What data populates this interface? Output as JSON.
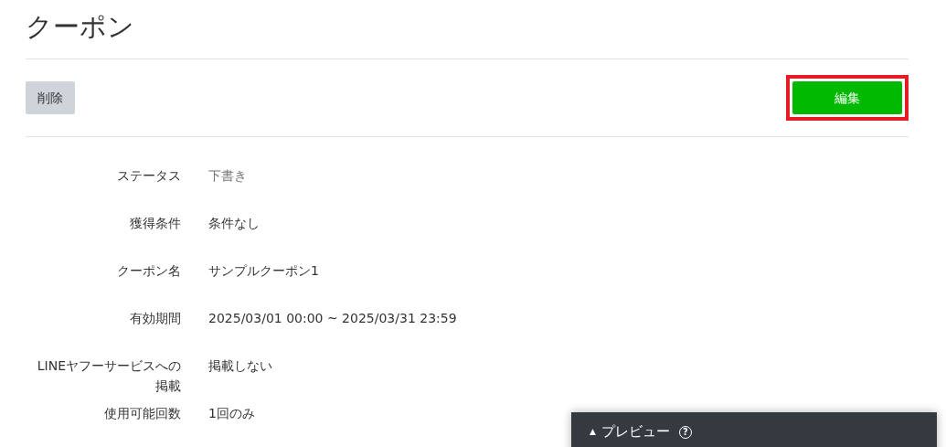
{
  "title": "クーポン",
  "actions": {
    "delete": {
      "label": "削除"
    },
    "edit": {
      "label": "編集",
      "highlighted": true
    }
  },
  "fields": [
    {
      "label": "ステータス",
      "value": "下書き",
      "muted": true
    },
    {
      "label": "獲得条件",
      "value": "条件なし",
      "muted": false
    },
    {
      "label": "クーポン名",
      "value": "サンプルクーポン1",
      "muted": false
    },
    {
      "label": "有効期間",
      "value": "2025/03/01 00:00 ~ 2025/03/31 23:59",
      "muted": false
    },
    {
      "label": "LINEヤフーサービスへの掲載",
      "value": "掲載しない",
      "muted": false
    },
    {
      "label": "使用可能回数",
      "value": "1回のみ",
      "muted": false
    }
  ],
  "preview": {
    "toggle": "▲",
    "label": "プレビュー",
    "help": "?",
    "expanded": false
  }
}
